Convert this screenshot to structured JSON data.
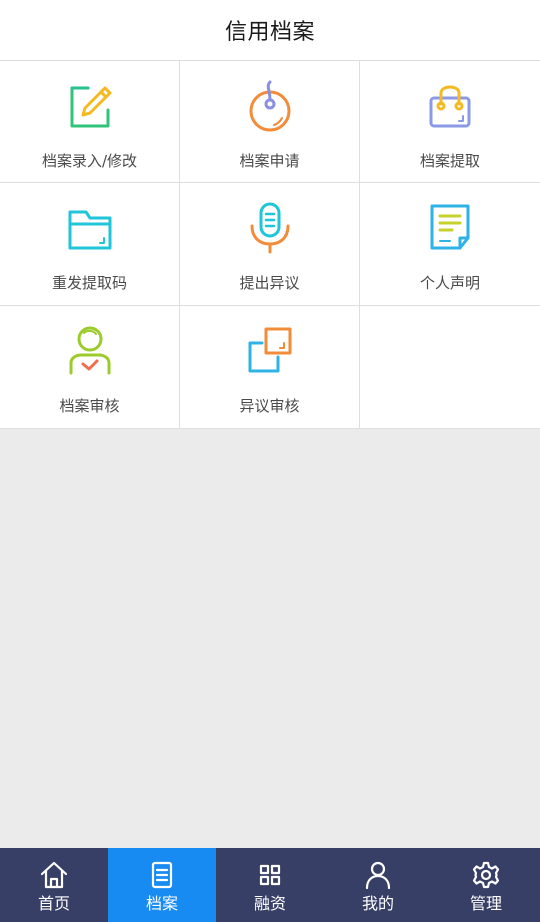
{
  "header": {
    "title": "信用档案"
  },
  "grid": {
    "items": [
      {
        "label": "档案录入/修改",
        "icon": "edit-icon",
        "color": "#2fc47a"
      },
      {
        "label": "档案申请",
        "icon": "mouse-icon",
        "color": "#f28c3a"
      },
      {
        "label": "档案提取",
        "icon": "bag-icon",
        "color": "#7b8fe0"
      },
      {
        "label": "重发提取码",
        "icon": "folder-icon",
        "color": "#1fc6d8"
      },
      {
        "label": "提出异议",
        "icon": "microphone-icon",
        "color": "#f28c3a"
      },
      {
        "label": "个人声明",
        "icon": "document-icon",
        "color": "#2fb3e6"
      },
      {
        "label": "档案审核",
        "icon": "user-check-icon",
        "color": "#9ccb2c"
      },
      {
        "label": "异议审核",
        "icon": "copy-icon",
        "color": "#f28c3a"
      }
    ]
  },
  "tabbar": {
    "active_color": "#178bf2",
    "background": "#383f66",
    "tabs": [
      {
        "label": "首页",
        "icon": "home-icon",
        "active": false
      },
      {
        "label": "档案",
        "icon": "file-list-icon",
        "active": true
      },
      {
        "label": "融资",
        "icon": "grid-icon",
        "active": false
      },
      {
        "label": "我的",
        "icon": "user-icon",
        "active": false
      },
      {
        "label": "管理",
        "icon": "gear-icon",
        "active": false
      }
    ]
  }
}
